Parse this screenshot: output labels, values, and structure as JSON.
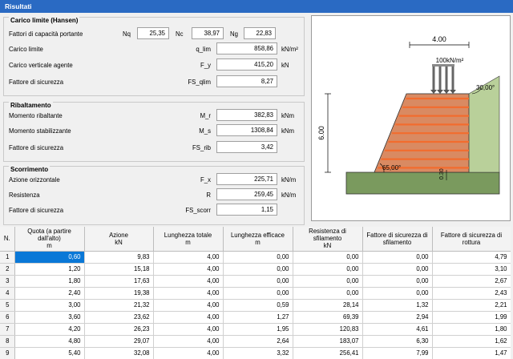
{
  "title": "Risultati",
  "carico": {
    "title": "Carico limite (Hansen)",
    "fattori_label": "Fattori di capacità portante",
    "nq_label": "Nq",
    "nq": "25,35",
    "nc_label": "Nc",
    "nc": "38,97",
    "ng_label": "Ng",
    "ng": "22,83",
    "rows": [
      {
        "label": "Carico limite",
        "sym": "q_lim",
        "value": "858,86",
        "unit": "kN/m²"
      },
      {
        "label": "Carico verticale agente",
        "sym": "F_y",
        "value": "415,20",
        "unit": "kN"
      },
      {
        "label": "Fattore di sicurezza",
        "sym": "FS_qlim",
        "value": "8,27",
        "unit": ""
      }
    ]
  },
  "ribaltamento": {
    "title": "Ribaltamento",
    "rows": [
      {
        "label": "Momento ribaltante",
        "sym": "M_r",
        "value": "382,83",
        "unit": "kNm"
      },
      {
        "label": "Momento stabilizzante",
        "sym": "M_s",
        "value": "1308,84",
        "unit": "kNm"
      },
      {
        "label": "Fattore di sicurezza",
        "sym": "FS_rib",
        "value": "3,42",
        "unit": ""
      }
    ]
  },
  "scorrimento": {
    "title": "Scorrimento",
    "rows": [
      {
        "label": "Azione orizzontale",
        "sym": "F_x",
        "value": "225,71",
        "unit": "kN/m"
      },
      {
        "label": "Resistenza",
        "sym": "R",
        "value": "259,45",
        "unit": "kN/m"
      },
      {
        "label": "Fattore di sicurezza",
        "sym": "FS_scorr",
        "value": "1,15",
        "unit": ""
      }
    ]
  },
  "drawing": {
    "width_label": "4.00",
    "load_label": "100kN/m²",
    "slope_angle_label": "30,00°",
    "height_label": "6.00",
    "wall_angle_label": "65,00°",
    "embed_label": "0.30",
    "colors": {
      "soil": "#b9d09a",
      "ground": "#7a9a5e",
      "wall": "#d98a62",
      "reinf": "#f26c2e",
      "load": "#8a8a8a"
    },
    "reinforcement_count": 9
  },
  "table": {
    "headers": [
      "N.",
      "Quota (a partire dall'alto)\nm",
      "Azione\nkN",
      "Lunghezza totale\nm",
      "Lunghezza efficace\nm",
      "Resistenza di sfilamento\nkN",
      "Fattore di sicurezza di sfilamento",
      "Fattore di sicurezza di rottura"
    ],
    "rows": [
      [
        "1",
        "0,60",
        "9,83",
        "4,00",
        "0,00",
        "0,00",
        "0,00",
        "4,79"
      ],
      [
        "2",
        "1,20",
        "15,18",
        "4,00",
        "0,00",
        "0,00",
        "0,00",
        "3,10"
      ],
      [
        "3",
        "1,80",
        "17,63",
        "4,00",
        "0,00",
        "0,00",
        "0,00",
        "2,67"
      ],
      [
        "4",
        "2,40",
        "19,38",
        "4,00",
        "0,00",
        "0,00",
        "0,00",
        "2,43"
      ],
      [
        "5",
        "3,00",
        "21,32",
        "4,00",
        "0,59",
        "28,14",
        "1,32",
        "2,21"
      ],
      [
        "6",
        "3,60",
        "23,62",
        "4,00",
        "1,27",
        "69,39",
        "2,94",
        "1,99"
      ],
      [
        "7",
        "4,20",
        "26,23",
        "4,00",
        "1,95",
        "120,83",
        "4,61",
        "1,80"
      ],
      [
        "8",
        "4,80",
        "29,07",
        "4,00",
        "2,64",
        "183,07",
        "6,30",
        "1,62"
      ],
      [
        "9",
        "5,40",
        "32,08",
        "4,00",
        "3,32",
        "256,41",
        "7,99",
        "1,47"
      ]
    ]
  }
}
